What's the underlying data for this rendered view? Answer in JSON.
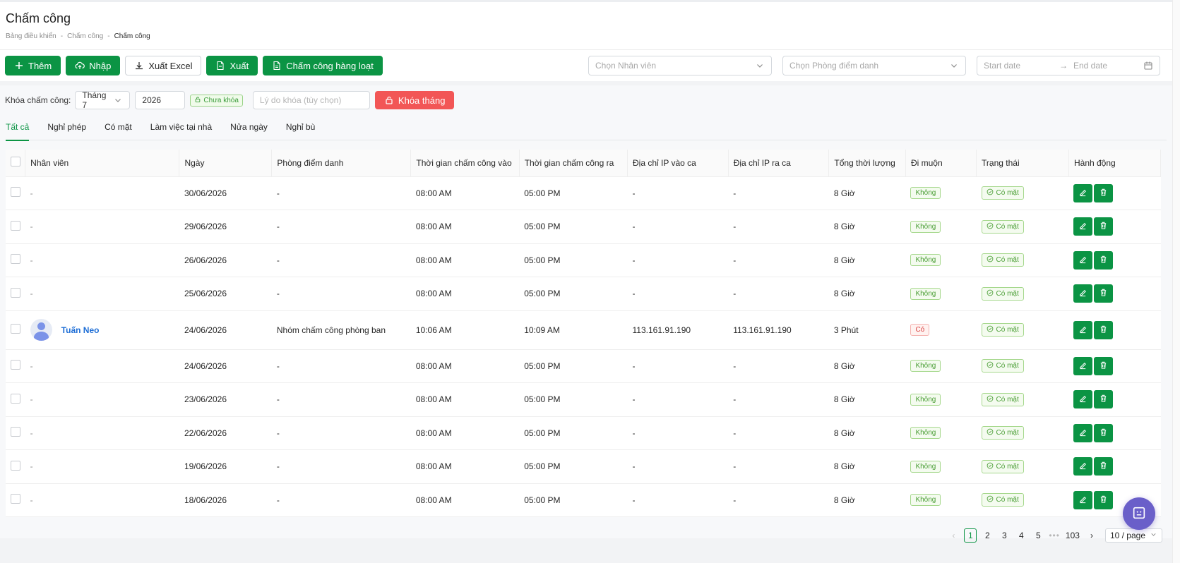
{
  "header": {
    "title": "Chấm công",
    "breadcrumb": [
      "Bảng điều khiển",
      "Chấm công",
      "Chấm công"
    ],
    "breadcrumb_sep": "-"
  },
  "toolbar": {
    "add_label": "Thêm",
    "import_label": "Nhập",
    "export_excel_label": "Xuất Excel",
    "export_label": "Xuất",
    "bulk_label": "Chấm công hàng loạt",
    "employee_placeholder": "Chọn Nhân viên",
    "room_placeholder": "Chọn Phòng điểm danh",
    "start_date_placeholder": "Start date",
    "end_date_placeholder": "End date"
  },
  "lockbar": {
    "label": "Khóa chấm công:",
    "month": "Tháng 7",
    "year": "2026",
    "status": "Chưa khóa",
    "reason_placeholder": "Lý do khóa (tùy chọn)",
    "lock_button": "Khóa tháng"
  },
  "tabs": [
    "Tất cả",
    "Nghỉ phép",
    "Có mặt",
    "Làm việc tại nhà",
    "Nửa ngày",
    "Nghỉ bù"
  ],
  "table": {
    "columns": [
      "Nhân viên",
      "Ngày",
      "Phòng điểm danh",
      "Thời gian chấm công vào",
      "Thời gian chấm công ra",
      "Địa chỉ IP vào ca",
      "Địa chỉ IP ra ca",
      "Tổng thời lượng",
      "Đi muộn",
      "Trạng thái",
      "Hành động"
    ],
    "rows": [
      {
        "employee": "-",
        "date": "30/06/2026",
        "room": "-",
        "in": "08:00 AM",
        "out": "05:00 PM",
        "ip_in": "-",
        "ip_out": "-",
        "total": "8 Giờ",
        "late": "Không",
        "status": "Có mặt"
      },
      {
        "employee": "-",
        "date": "29/06/2026",
        "room": "-",
        "in": "08:00 AM",
        "out": "05:00 PM",
        "ip_in": "-",
        "ip_out": "-",
        "total": "8 Giờ",
        "late": "Không",
        "status": "Có mặt"
      },
      {
        "employee": "-",
        "date": "26/06/2026",
        "room": "-",
        "in": "08:00 AM",
        "out": "05:00 PM",
        "ip_in": "-",
        "ip_out": "-",
        "total": "8 Giờ",
        "late": "Không",
        "status": "Có mặt"
      },
      {
        "employee": "-",
        "date": "25/06/2026",
        "room": "-",
        "in": "08:00 AM",
        "out": "05:00 PM",
        "ip_in": "-",
        "ip_out": "-",
        "total": "8 Giờ",
        "late": "Không",
        "status": "Có mặt"
      },
      {
        "employee": "Tuấn Neo",
        "date": "24/06/2026",
        "room": "Nhóm chấm công phòng ban",
        "in": "10:06 AM",
        "out": "10:09 AM",
        "ip_in": "113.161.91.190",
        "ip_out": "113.161.91.190",
        "total": "3 Phút",
        "late": "Có",
        "status": "Có mặt"
      },
      {
        "employee": "-",
        "date": "24/06/2026",
        "room": "-",
        "in": "08:00 AM",
        "out": "05:00 PM",
        "ip_in": "-",
        "ip_out": "-",
        "total": "8 Giờ",
        "late": "Không",
        "status": "Có mặt"
      },
      {
        "employee": "-",
        "date": "23/06/2026",
        "room": "-",
        "in": "08:00 AM",
        "out": "05:00 PM",
        "ip_in": "-",
        "ip_out": "-",
        "total": "8 Giờ",
        "late": "Không",
        "status": "Có mặt"
      },
      {
        "employee": "-",
        "date": "22/06/2026",
        "room": "-",
        "in": "08:00 AM",
        "out": "05:00 PM",
        "ip_in": "-",
        "ip_out": "-",
        "total": "8 Giờ",
        "late": "Không",
        "status": "Có mặt"
      },
      {
        "employee": "-",
        "date": "19/06/2026",
        "room": "-",
        "in": "08:00 AM",
        "out": "05:00 PM",
        "ip_in": "-",
        "ip_out": "-",
        "total": "8 Giờ",
        "late": "Không",
        "status": "Có mặt"
      },
      {
        "employee": "-",
        "date": "18/06/2026",
        "room": "-",
        "in": "08:00 AM",
        "out": "05:00 PM",
        "ip_in": "-",
        "ip_out": "-",
        "total": "8 Giờ",
        "late": "Không",
        "status": "Có mặt"
      }
    ]
  },
  "pagination": {
    "pages": [
      "1",
      "2",
      "3",
      "4",
      "5"
    ],
    "current": "1",
    "last": "103",
    "per_page": "10 / page"
  },
  "colors": {
    "primary": "#0b9444",
    "danger": "#f25656",
    "link": "#1f6fd6",
    "fab": "#6a5fc9"
  },
  "icons": [
    "plus-icon",
    "cloud-upload-icon",
    "download-icon",
    "file-export-icon",
    "file-bulk-icon",
    "chevron-down-icon",
    "arrow-right-icon",
    "calendar-icon",
    "lock-icon",
    "check-circle-icon",
    "edit-icon",
    "trash-icon",
    "chevron-left-icon",
    "chevron-right-icon",
    "bot-icon"
  ]
}
